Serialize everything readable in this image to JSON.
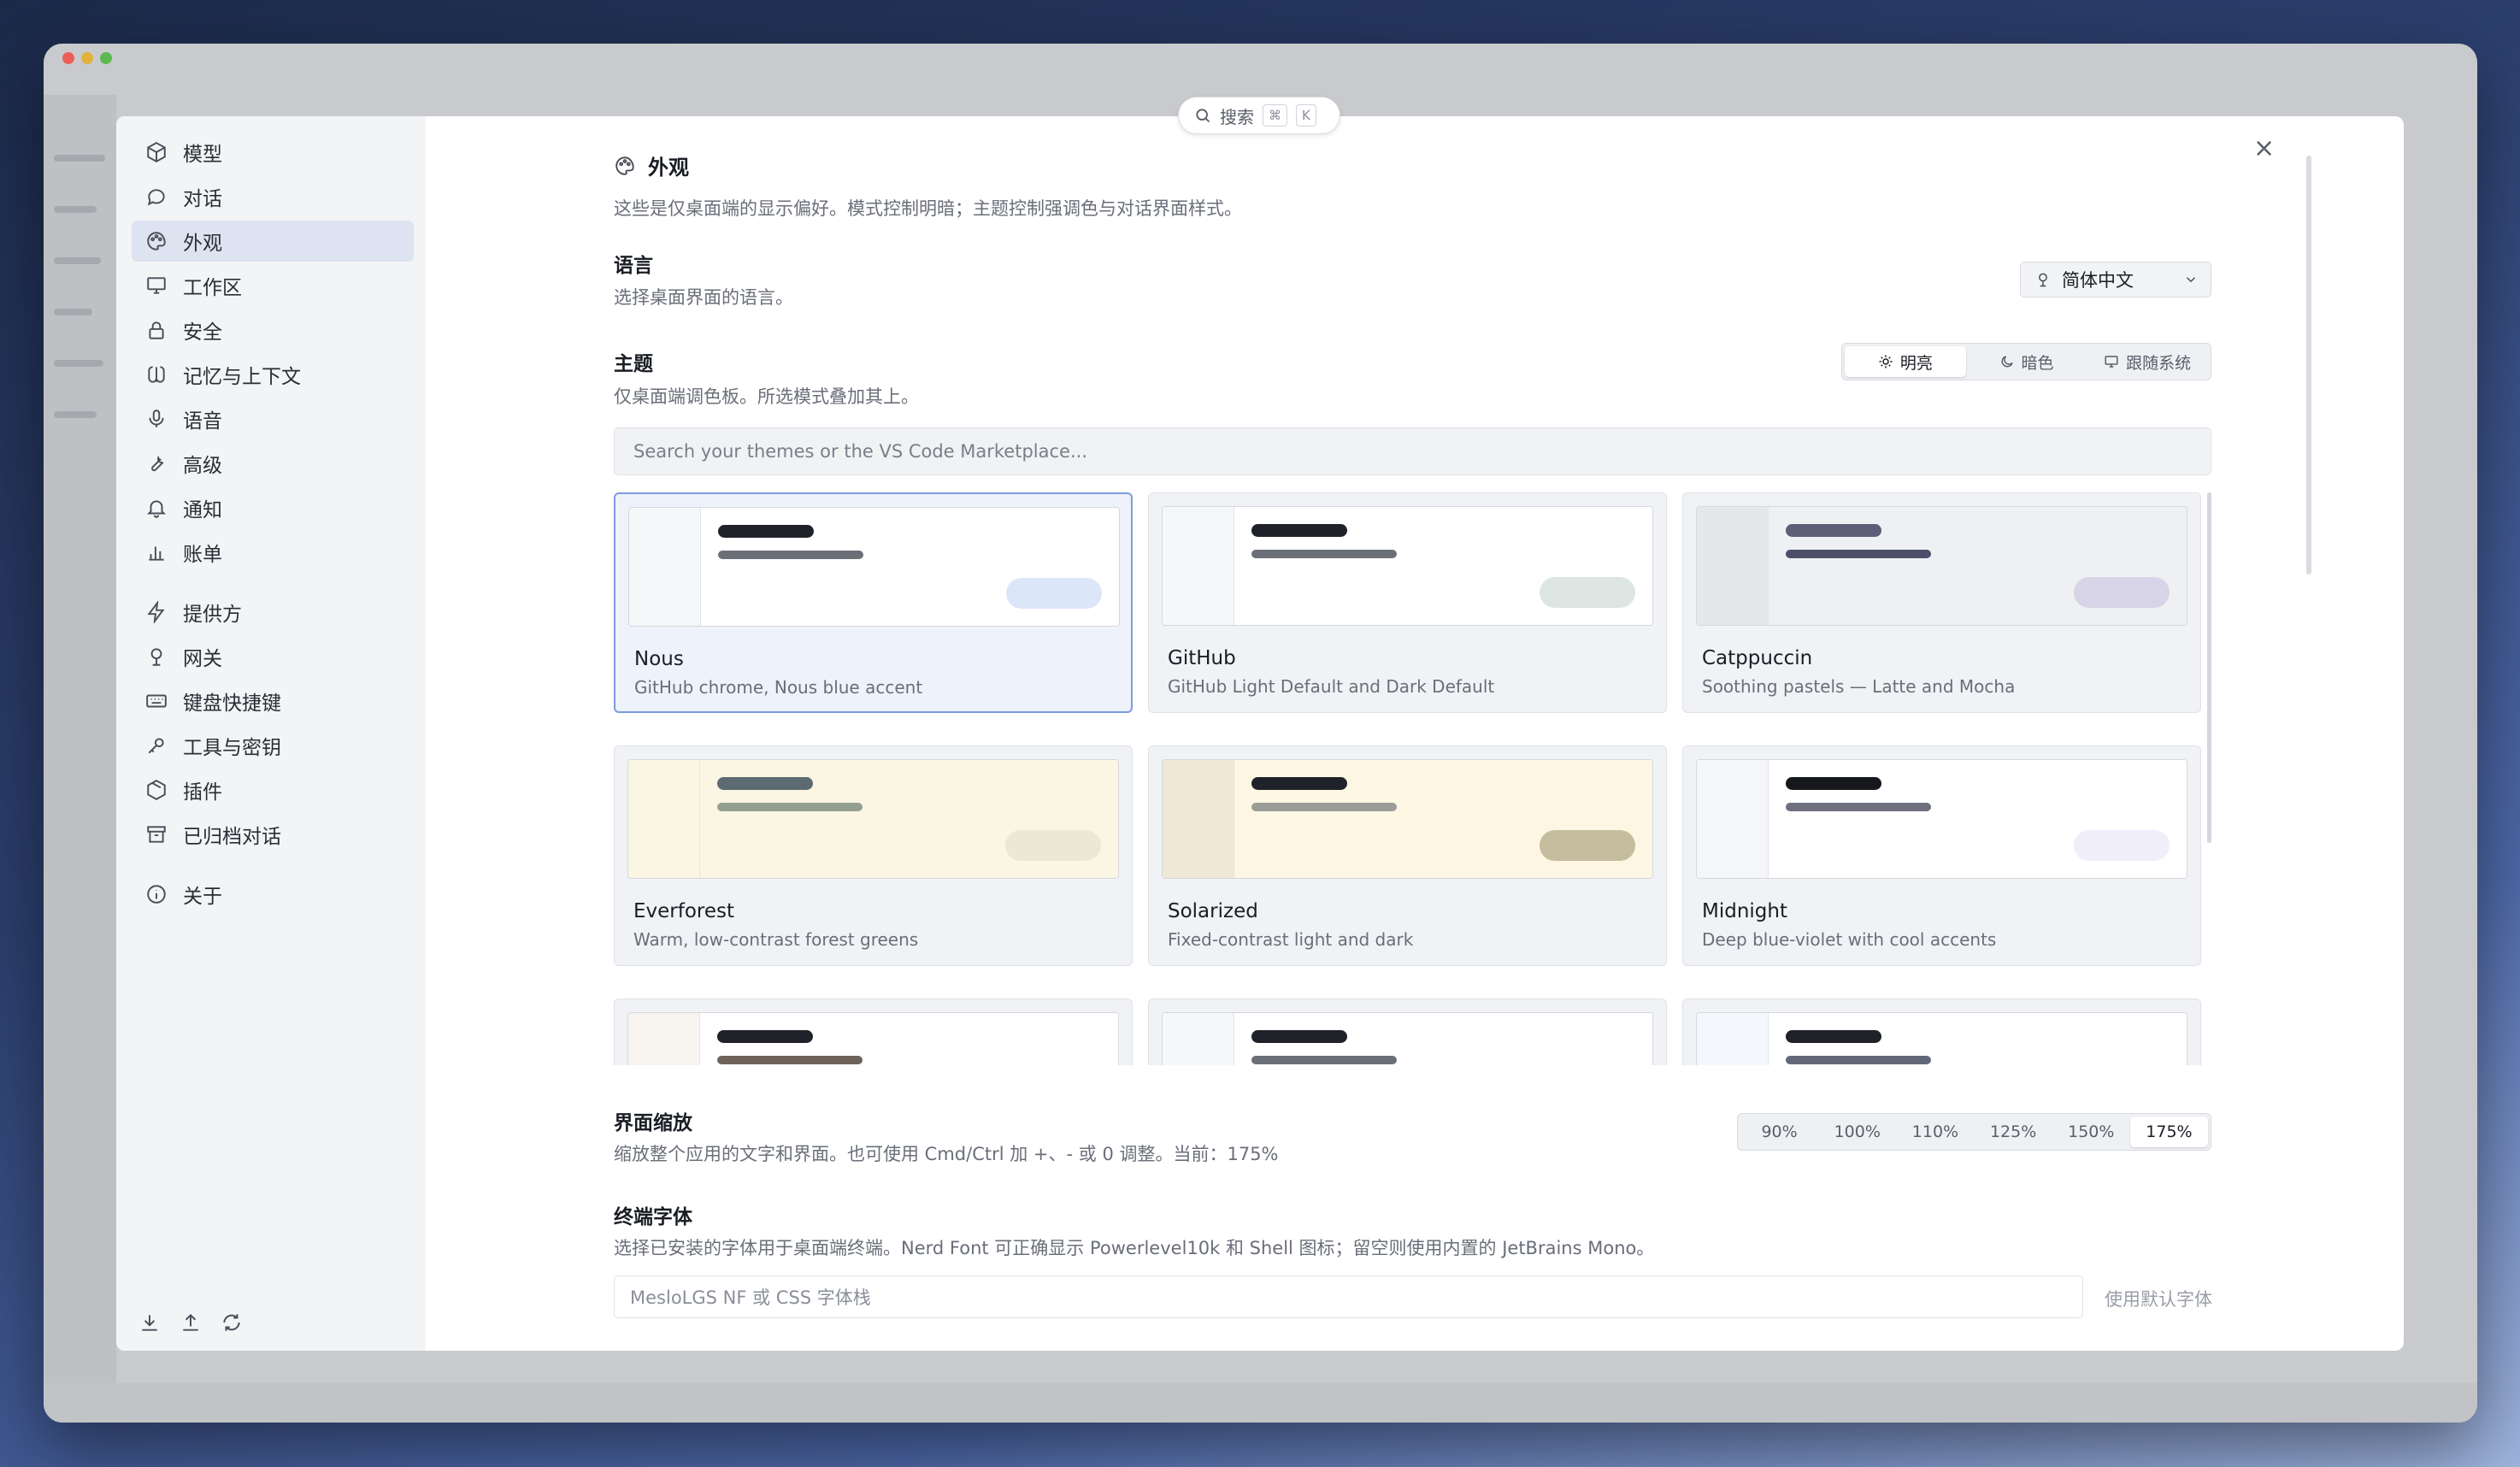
{
  "top_search": {
    "label": "搜索",
    "key1": "⌘",
    "key2": "K"
  },
  "sidebar": {
    "items": [
      {
        "label": "模型",
        "icon": "cube-icon"
      },
      {
        "label": "对话",
        "icon": "chat-icon"
      },
      {
        "label": "外观",
        "icon": "palette-icon"
      },
      {
        "label": "工作区",
        "icon": "monitor-icon"
      },
      {
        "label": "安全",
        "icon": "lock-icon"
      },
      {
        "label": "记忆与上下文",
        "icon": "brain-icon"
      },
      {
        "label": "语音",
        "icon": "mic-icon"
      },
      {
        "label": "高级",
        "icon": "wrench-icon"
      },
      {
        "label": "通知",
        "icon": "bell-icon"
      },
      {
        "label": "账单",
        "icon": "bar-chart-icon"
      },
      {
        "label": "提供方",
        "icon": "bolt-icon"
      },
      {
        "label": "网关",
        "icon": "gateway-icon"
      },
      {
        "label": "键盘快捷键",
        "icon": "keyboard-icon"
      },
      {
        "label": "工具与密钥",
        "icon": "key-icon"
      },
      {
        "label": "插件",
        "icon": "package-icon"
      },
      {
        "label": "已归档对话",
        "icon": "archive-icon"
      },
      {
        "label": "关于",
        "icon": "info-icon"
      }
    ],
    "active_index": 2
  },
  "main": {
    "title": "外观",
    "subtitle": "这些是仅桌面端的显示偏好。模式控制明暗；主题控制强调色与对话界面样式。",
    "language": {
      "label": "语言",
      "desc": "选择桌面界面的语言。",
      "value": "简体中文"
    },
    "theme": {
      "label": "主题",
      "desc": "仅桌面端调色板。所选模式叠加其上。",
      "modes": [
        "明亮",
        "暗色",
        "跟随系统"
      ],
      "active_mode": 0,
      "search_placeholder": "Search your themes or the VS Code Marketplace...",
      "cards": [
        {
          "name": "Nous",
          "desc": "GitHub chrome, Nous blue accent",
          "selected": true,
          "colors": {
            "side": "#f6f7f9",
            "main": "#ffffff",
            "b1": "#1f2329",
            "b2": "#6b6f78",
            "pill": "#dbe6f8"
          }
        },
        {
          "name": "GitHub",
          "desc": "GitHub Light Default and Dark Default",
          "colors": {
            "side": "#f6f7f9",
            "main": "#ffffff",
            "b1": "#1f2329",
            "b2": "#6b6f78",
            "pill": "#dde6e2"
          }
        },
        {
          "name": "Catppuccin",
          "desc": "Soothing pastels — Latte and Mocha",
          "colors": {
            "side": "#e6e7eb",
            "main": "#eff0f4",
            "b1": "#5c5f77",
            "b2": "#4c4f69",
            "pill": "#d6d4e6"
          }
        },
        {
          "name": "Everforest",
          "desc": "Warm, low-contrast forest greens",
          "colors": {
            "side": "#fbf6e3",
            "main": "#fbf6e3",
            "b1": "#5c6a72",
            "b2": "#939f91",
            "pill": "#ebe8d6"
          }
        },
        {
          "name": "Solarized",
          "desc": "Fixed-contrast light and dark",
          "colors": {
            "side": "#eee8d5",
            "main": "#fdf6e3",
            "b1": "#1f2329",
            "b2": "#9a9c98",
            "pill": "#c6bc9e"
          }
        },
        {
          "name": "Midnight",
          "desc": "Deep blue-violet with cool accents",
          "colors": {
            "side": "#f5f6f9",
            "main": "#ffffff",
            "b1": "#16181d",
            "b2": "#6e707e",
            "pill": "#efeefa"
          }
        },
        {
          "name": "",
          "desc": "",
          "colors": {
            "side": "#f8f5f1",
            "main": "#ffffff",
            "b1": "#1f2329",
            "b2": "#6e635a",
            "pill": "#f7ece3"
          }
        },
        {
          "name": "",
          "desc": "",
          "colors": {
            "side": "#f6f7f9",
            "main": "#ffffff",
            "b1": "#1f2329",
            "b2": "#6b6f78",
            "pill": "#eeeff1"
          }
        },
        {
          "name": "",
          "desc": "",
          "colors": {
            "side": "#f4f7fb",
            "main": "#ffffff",
            "b1": "#1f2329",
            "b2": "#626878",
            "pill": "#e8f0fa"
          }
        }
      ]
    },
    "scale": {
      "label": "界面缩放",
      "desc": "缩放整个应用的文字和界面。也可使用 Cmd/Ctrl 加 +、- 或 0 调整。当前：175%",
      "options": [
        "90%",
        "100%",
        "110%",
        "125%",
        "150%",
        "175%"
      ],
      "active": 5
    },
    "terminal_font": {
      "label": "终端字体",
      "desc": "选择已安装的字体用于桌面端终端。Nerd Font 可正确显示 Powerlevel10k 和 Shell 图标；留空则使用内置的 JetBrains Mono。",
      "placeholder": "MesloLGS NF 或 CSS 字体栈",
      "default_label": "使用默认字体"
    }
  }
}
